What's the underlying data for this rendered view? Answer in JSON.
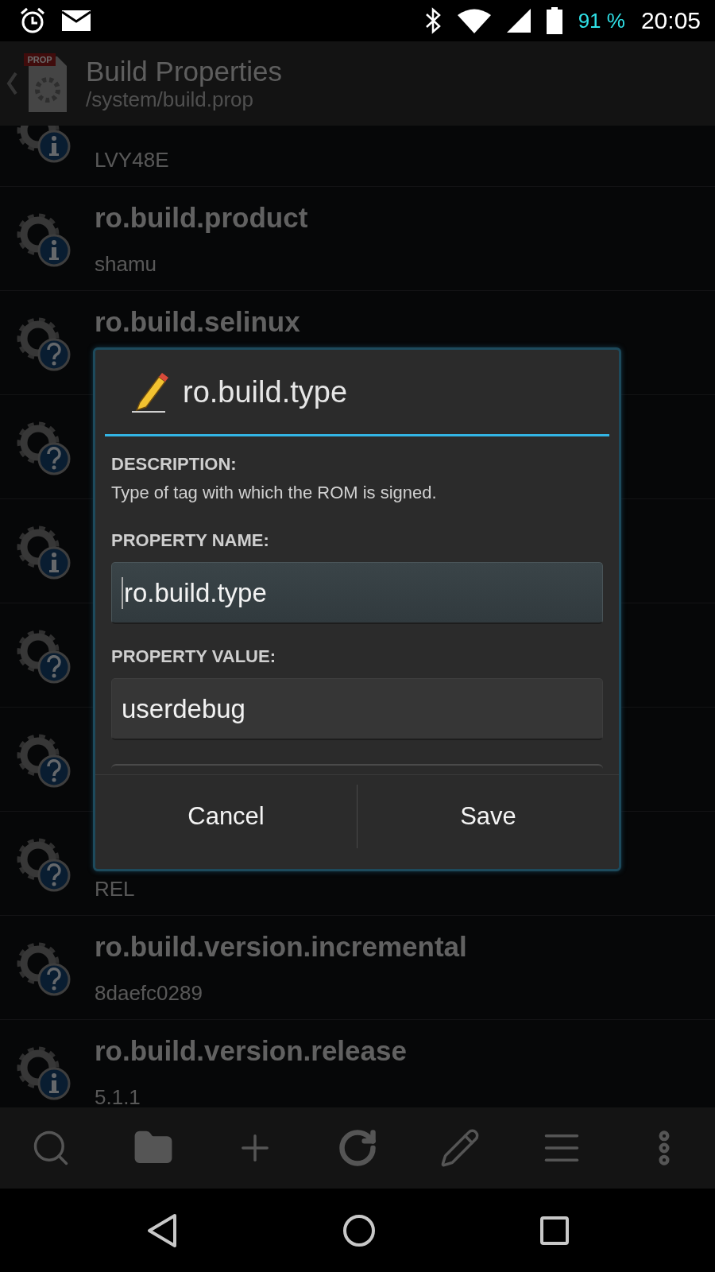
{
  "status_bar": {
    "battery_percent": "91 %",
    "time": "20:05"
  },
  "app_bar": {
    "icon_label": "PROP",
    "title": "Build Properties",
    "subtitle": "/system/build.prop"
  },
  "properties": [
    {
      "kind": "info",
      "value": "LVY48E"
    },
    {
      "kind": "info",
      "name": "ro.build.product",
      "value": "shamu"
    },
    {
      "kind": "unknown",
      "name": "ro.build.selinux"
    },
    {
      "kind": "unknown"
    },
    {
      "kind": "info"
    },
    {
      "kind": "unknown"
    },
    {
      "kind": "unknown"
    },
    {
      "kind": "unknown",
      "value": "REL"
    },
    {
      "kind": "unknown",
      "name": "ro.build.version.incremental",
      "value": "8daefc0289"
    },
    {
      "kind": "info",
      "name": "ro.build.version.release",
      "value": "5.1.1"
    }
  ],
  "dialog": {
    "title": "ro.build.type",
    "description_label": "DESCRIPTION:",
    "description": "Type of tag with which the ROM is signed.",
    "fields": [
      {
        "label": "PROPERTY NAME:",
        "value": "ro.build.type",
        "focused": true
      },
      {
        "label": "PROPERTY VALUE:",
        "value": "userdebug",
        "focused": false
      }
    ],
    "buttons": [
      "Cancel",
      "Save"
    ]
  },
  "toolbar": [
    {
      "kind": "search"
    },
    {
      "kind": "folder"
    },
    {
      "kind": "add"
    },
    {
      "kind": "refresh"
    },
    {
      "kind": "edit"
    },
    {
      "kind": "list"
    },
    {
      "kind": "more"
    }
  ]
}
